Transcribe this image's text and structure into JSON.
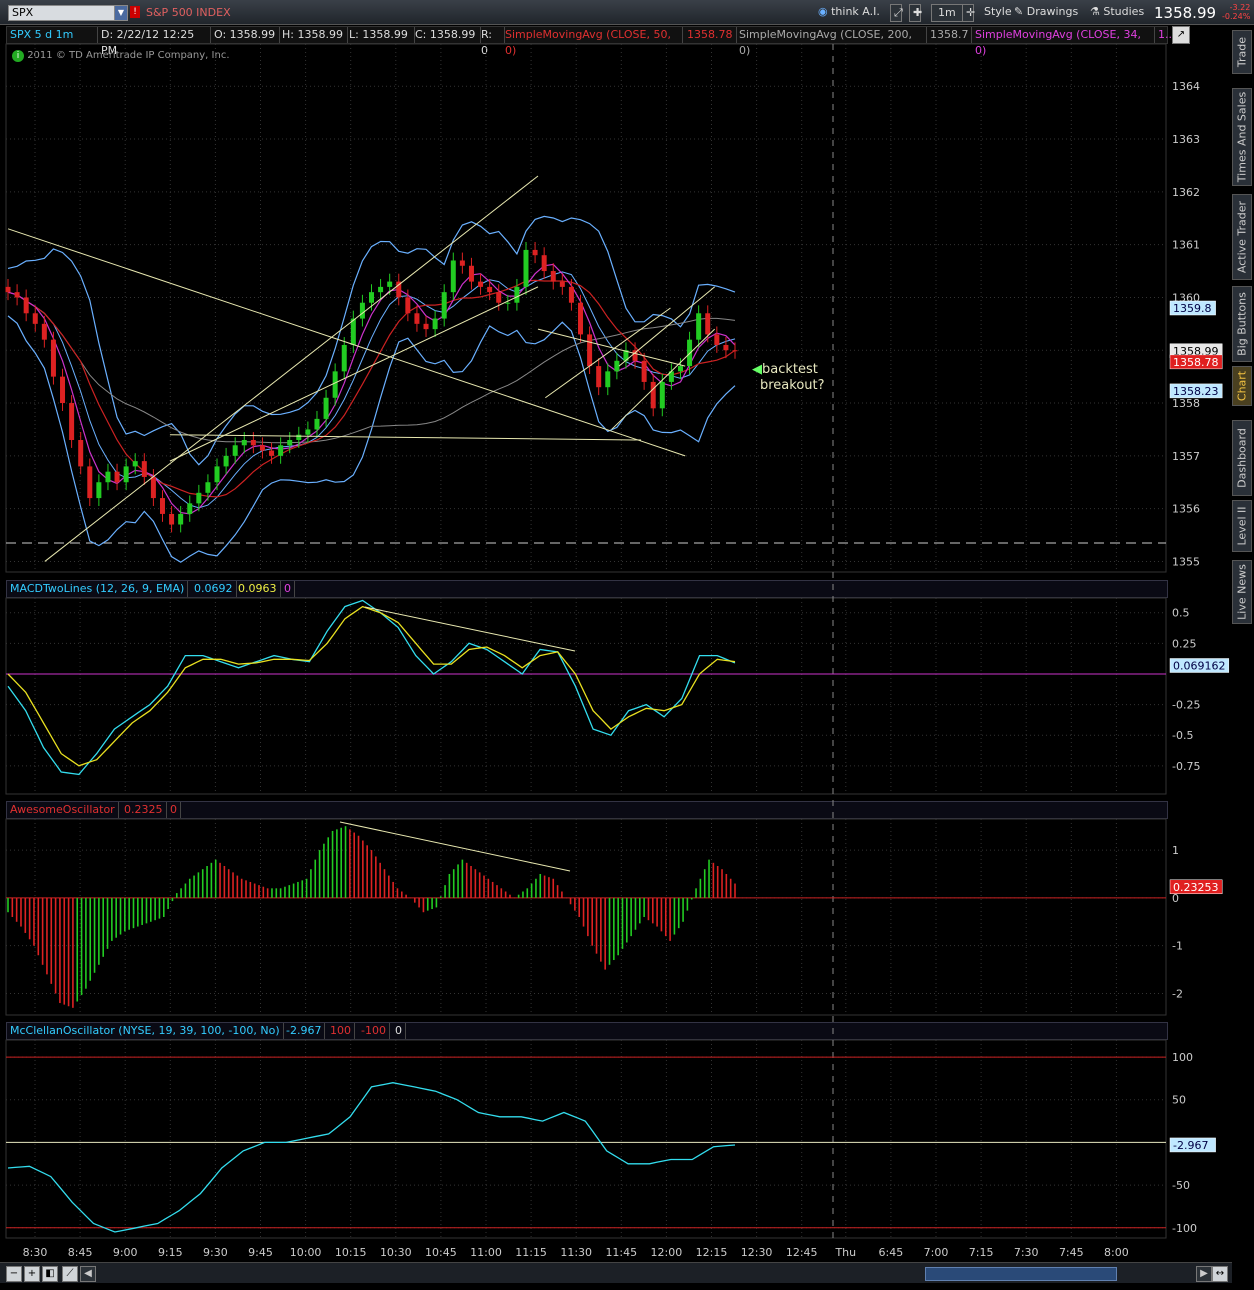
{
  "toolbar": {
    "symbol": "SPX",
    "description": "S&P 500 INDEX",
    "warning": "!",
    "think": "think A.I.",
    "timeframe": "1m",
    "style": "Style",
    "drawings": "Drawings",
    "studies": "Studies",
    "last": "1358.99",
    "change": "-3.22",
    "change_pct": "-0.24%"
  },
  "status": {
    "symbol_period": "SPX 5 d 1m",
    "date": "D: 2/22/12 12:25 PM",
    "open": "O: 1358.99",
    "high": "H: 1358.99",
    "low": "L: 1358.99",
    "close": "C: 1358.99",
    "r": "R: 0",
    "sma50_label": "SimpleMovingAvg (CLOSE, 50, 0)",
    "sma50_val": "1358.78",
    "sma200_label": "SimpleMovingAvg (CLOSE, 200, 0)",
    "sma200_val": "1358.7",
    "sma34_label": "SimpleMovingAvg (CLOSE, 34, 0)",
    "sma34_val": "1.."
  },
  "copyright": "2011 © TD Ameritrade IP Company, Inc.",
  "annotation": {
    "line1": "backtest",
    "line2": "breakout?"
  },
  "panels": {
    "macd": {
      "name": "MACDTwoLines (12, 26, 9, EMA)",
      "v1": "0.0692",
      "v2": "0.0963",
      "v3": "0"
    },
    "ao": {
      "name": "AwesomeOscillator",
      "v1": "0.2325",
      "v2": "0"
    },
    "mcc": {
      "name": "McClellanOscillator (NYSE, 19, 39, 100, -100, No)",
      "v1": "-2.967",
      "v2": "100",
      "v3": "-100",
      "v4": "0"
    }
  },
  "price_badges": {
    "bb_upper": "1359.8",
    "last": "1358.99",
    "sma50": "1358.78",
    "bb_lower": "1358.23"
  },
  "macd_badge": "0.069162",
  "ao_badge": "0.23253",
  "mcc_badge": "-2.967",
  "side_tabs": [
    "Trade",
    "Times And Sales",
    "Active Trader",
    "Big Buttons",
    "Chart",
    "Dashboard",
    "Level II",
    "Live News"
  ],
  "colors": {
    "up": "#22cc22",
    "down": "#dd2222",
    "bb": "#6ab0ff",
    "sma50": "#cc2222",
    "sma34": "#cc33cc",
    "sma200": "#888888",
    "macd": "#33ddee",
    "signal": "#e8e020",
    "mcc": "#33ddee",
    "trend": "#e8e8b0"
  },
  "chart_data": [
    {
      "type": "candlestick",
      "title": "SPX 5 d 1m",
      "ylim": [
        1354.8,
        1364.8
      ],
      "y_ticks": [
        1355,
        1356,
        1357,
        1358,
        1359,
        1360,
        1361,
        1362,
        1363,
        1364
      ],
      "x_ticks": [
        "8:30",
        "8:45",
        "9:00",
        "9:15",
        "9:30",
        "9:45",
        "10:00",
        "10:15",
        "10:30",
        "10:45",
        "11:00",
        "11:15",
        "11:30",
        "11:45",
        "12:00",
        "12:15",
        "12:30",
        "12:45",
        "Thu",
        "6:45",
        "7:00",
        "7:15",
        "7:30",
        "7:45",
        "8:00"
      ],
      "close": [
        1360.1,
        1360.0,
        1359.7,
        1359.5,
        1359.2,
        1358.5,
        1358.0,
        1357.3,
        1356.8,
        1356.2,
        1356.5,
        1356.7,
        1356.5,
        1356.8,
        1356.9,
        1356.6,
        1356.2,
        1355.9,
        1355.7,
        1355.9,
        1356.1,
        1356.3,
        1356.5,
        1356.8,
        1357.0,
        1357.2,
        1357.3,
        1357.2,
        1357.1,
        1357.0,
        1357.2,
        1357.3,
        1357.4,
        1357.5,
        1357.7,
        1358.1,
        1358.6,
        1359.1,
        1359.6,
        1359.9,
        1360.1,
        1360.2,
        1360.3,
        1360.0,
        1359.7,
        1359.5,
        1359.4,
        1359.6,
        1360.1,
        1360.7,
        1360.6,
        1360.3,
        1360.2,
        1360.1,
        1359.9,
        1359.9,
        1360.2,
        1360.9,
        1360.8,
        1360.5,
        1360.3,
        1360.2,
        1359.9,
        1359.3,
        1358.7,
        1358.3,
        1358.6,
        1358.8,
        1359.0,
        1358.8,
        1358.4,
        1357.9,
        1358.4,
        1358.6,
        1358.7,
        1359.2,
        1359.7,
        1359.3,
        1359.1,
        1359.0,
        1358.99
      ]
    },
    {
      "type": "line",
      "title": "MACDTwoLines (12, 26, 9, EMA)",
      "ylim": [
        -0.98,
        0.62
      ],
      "y_ticks": [
        0.5,
        0.25,
        -0.25,
        -0.5,
        -0.75
      ],
      "series": [
        {
          "name": "Value",
          "values": [
            -0.1,
            -0.3,
            -0.6,
            -0.8,
            -0.82,
            -0.65,
            -0.45,
            -0.35,
            -0.25,
            -0.1,
            0.15,
            0.15,
            0.1,
            0.05,
            0.1,
            0.15,
            0.12,
            0.1,
            0.35,
            0.55,
            0.6,
            0.5,
            0.38,
            0.15,
            0.0,
            0.1,
            0.25,
            0.2,
            0.1,
            0.0,
            0.2,
            0.18,
            -0.1,
            -0.45,
            -0.5,
            -0.3,
            -0.25,
            -0.35,
            -0.2,
            0.15,
            0.15,
            0.09
          ]
        },
        {
          "name": "Avg",
          "values": [
            0.0,
            -0.15,
            -0.4,
            -0.65,
            -0.75,
            -0.7,
            -0.55,
            -0.4,
            -0.3,
            -0.15,
            0.05,
            0.12,
            0.12,
            0.08,
            0.09,
            0.12,
            0.12,
            0.11,
            0.25,
            0.45,
            0.55,
            0.5,
            0.42,
            0.25,
            0.08,
            0.08,
            0.2,
            0.22,
            0.15,
            0.05,
            0.15,
            0.18,
            0.0,
            -0.3,
            -0.45,
            -0.35,
            -0.28,
            -0.3,
            -0.25,
            0.0,
            0.12,
            0.1
          ]
        }
      ]
    },
    {
      "type": "bar",
      "title": "AwesomeOscillator",
      "ylim": [
        -2.45,
        1.65
      ],
      "y_ticks": [
        1,
        0,
        -1,
        -2
      ],
      "values": [
        -0.3,
        -0.6,
        -1.0,
        -1.6,
        -2.2,
        -2.3,
        -1.9,
        -1.4,
        -0.9,
        -0.7,
        -0.6,
        -0.5,
        -0.4,
        0.1,
        0.4,
        0.6,
        0.8,
        0.6,
        0.4,
        0.3,
        0.2,
        0.2,
        0.3,
        0.4,
        1.0,
        1.4,
        1.5,
        1.3,
        1.0,
        0.6,
        0.2,
        0.0,
        -0.3,
        -0.2,
        0.5,
        0.8,
        0.6,
        0.4,
        0.2,
        0.0,
        0.2,
        0.5,
        0.4,
        0.0,
        -0.4,
        -1.0,
        -1.5,
        -1.2,
        -0.8,
        -0.4,
        -0.6,
        -0.9,
        -0.5,
        0.2,
        0.8,
        0.6,
        0.3
      ]
    },
    {
      "type": "line",
      "title": "McClellanOscillator (NYSE, 19, 39, 100, -100, No)",
      "ylim": [
        -112,
        120
      ],
      "y_ticks": [
        100,
        50,
        -50,
        -100
      ],
      "series": [
        {
          "name": "McClellanOscillator",
          "values": [
            -30,
            -28,
            -40,
            -70,
            -95,
            -105,
            -100,
            -95,
            -80,
            -60,
            -30,
            -10,
            0,
            0,
            5,
            10,
            30,
            65,
            70,
            65,
            60,
            50,
            35,
            30,
            30,
            25,
            35,
            25,
            -10,
            -25,
            -25,
            -20,
            -20,
            -5,
            -3
          ]
        }
      ]
    }
  ]
}
